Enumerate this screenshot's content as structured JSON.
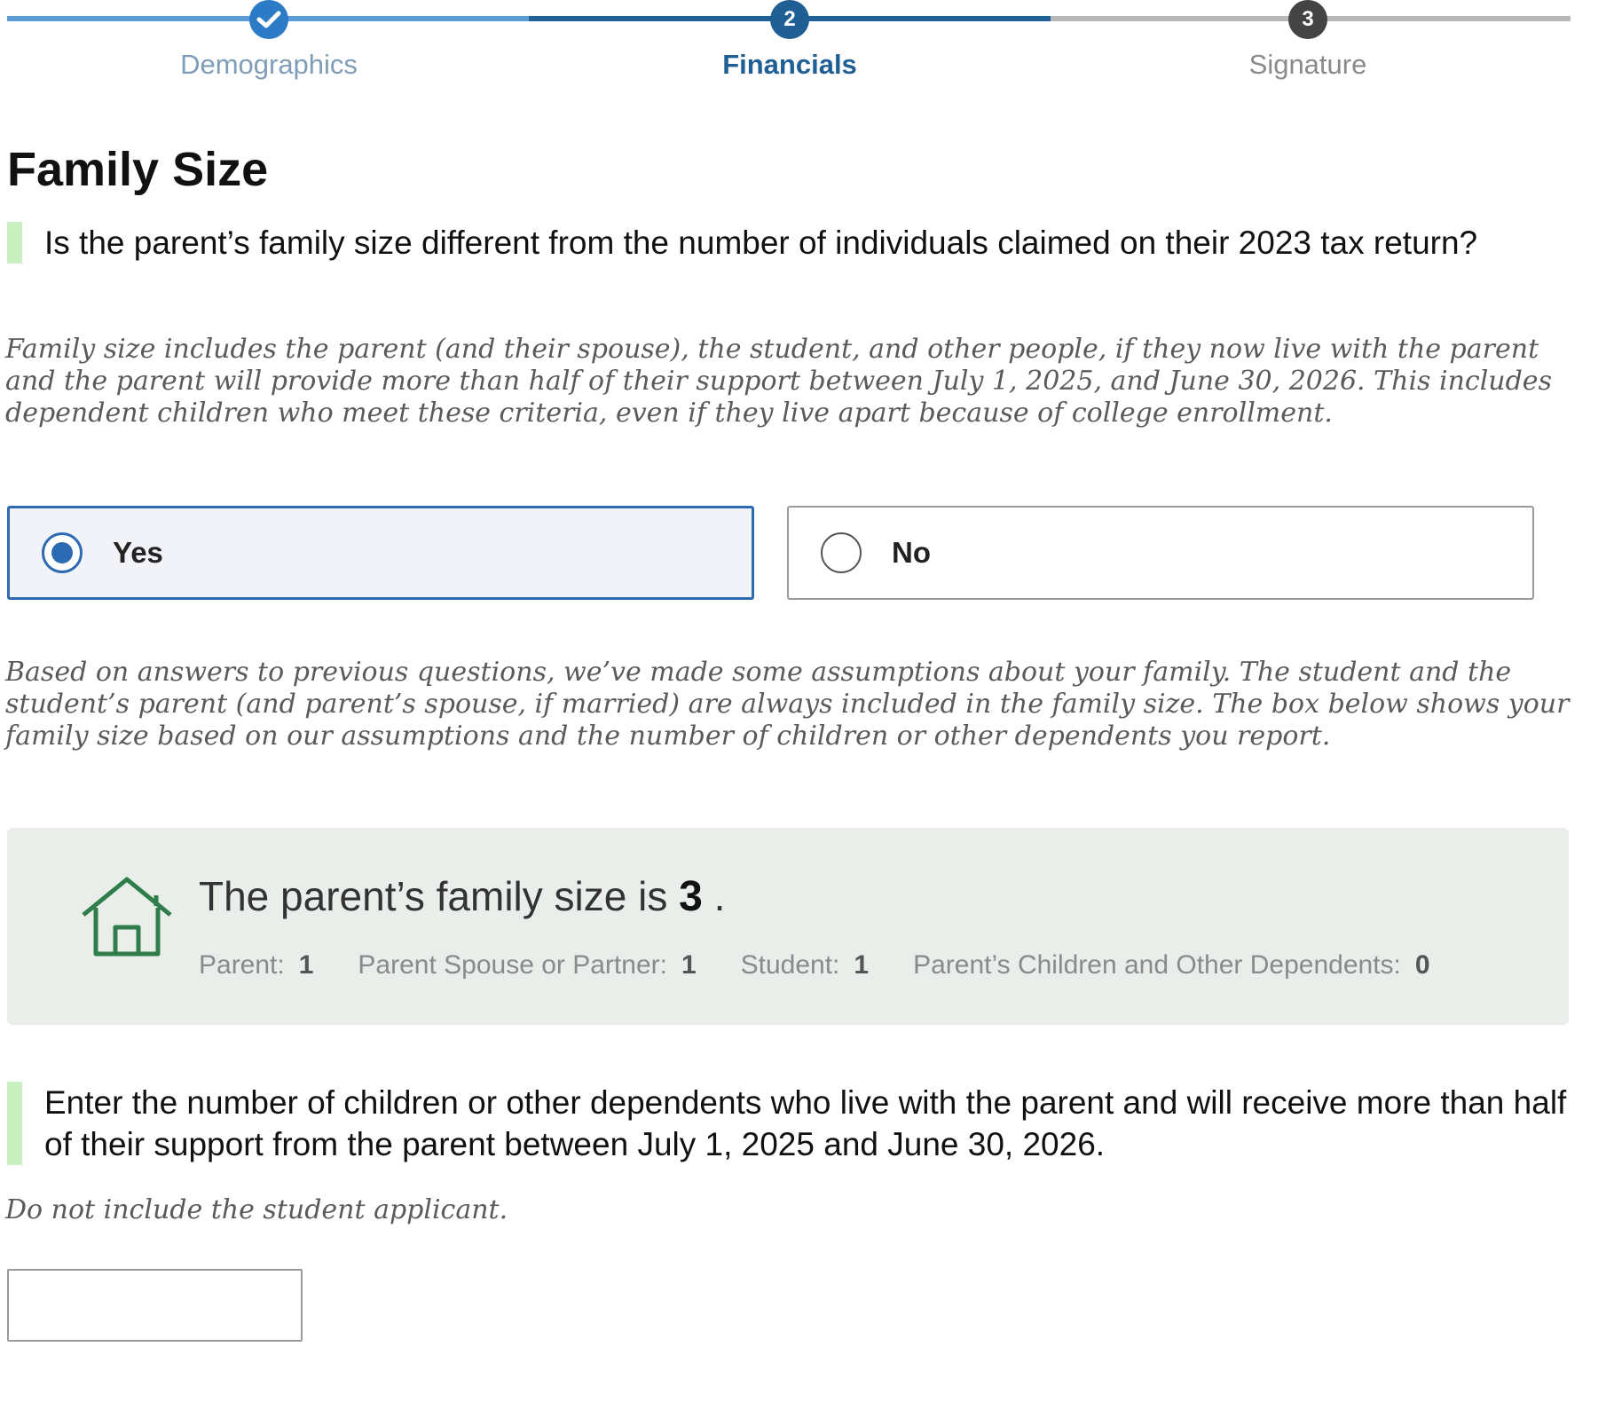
{
  "stepper": {
    "steps": [
      {
        "number": "1",
        "label": "Demographics",
        "status": "complete"
      },
      {
        "number": "2",
        "label": "Financials",
        "status": "current"
      },
      {
        "number": "3",
        "label": "Signature",
        "status": "upcoming"
      }
    ]
  },
  "page_title": "Family Size",
  "question1": {
    "text": "Is the parent’s family size different from the number of individuals claimed on their 2023 tax return?",
    "hint": "Family size includes the parent (and their spouse), the student, and other people, if they now live with the parent and the parent will provide more than half of their support between July 1, 2025, and June 30, 2026. This includes dependent children who meet these criteria, even if they live apart because of college enrollment.",
    "options": [
      {
        "label": "Yes",
        "selected": true
      },
      {
        "label": "No",
        "selected": false
      }
    ]
  },
  "assumptions_note": "Based on answers to previous questions, we’ve made some assumptions about your family. The student and the student’s parent (and parent’s spouse, if married) are always included in the family size. The box below shows your family size based on our assumptions and the number of children or other dependents you report.",
  "family_summary": {
    "icon": "house-icon",
    "sentence_prefix": "The parent’s family size is",
    "size": "3",
    "sentence_suffix": ".",
    "breakdown": [
      {
        "label": "Parent:",
        "value": "1"
      },
      {
        "label": "Parent Spouse or Partner:",
        "value": "1"
      },
      {
        "label": "Student:",
        "value": "1"
      },
      {
        "label": "Parent’s Children and Other Dependents:",
        "value": "0"
      }
    ]
  },
  "question2": {
    "text": "Enter the number of children or other dependents who live with the parent and will receive more than half of their support from the parent between July 1, 2025 and June 30, 2026.",
    "hint": "Do not include the student applicant.",
    "value": "",
    "placeholder": ""
  },
  "colors": {
    "accent": "#2c6bb3",
    "stepper_active": "#1f5f94",
    "question_bar": "#c9eec0",
    "summary_bg": "#e9eeea",
    "house_icon": "#2e7d4a"
  }
}
